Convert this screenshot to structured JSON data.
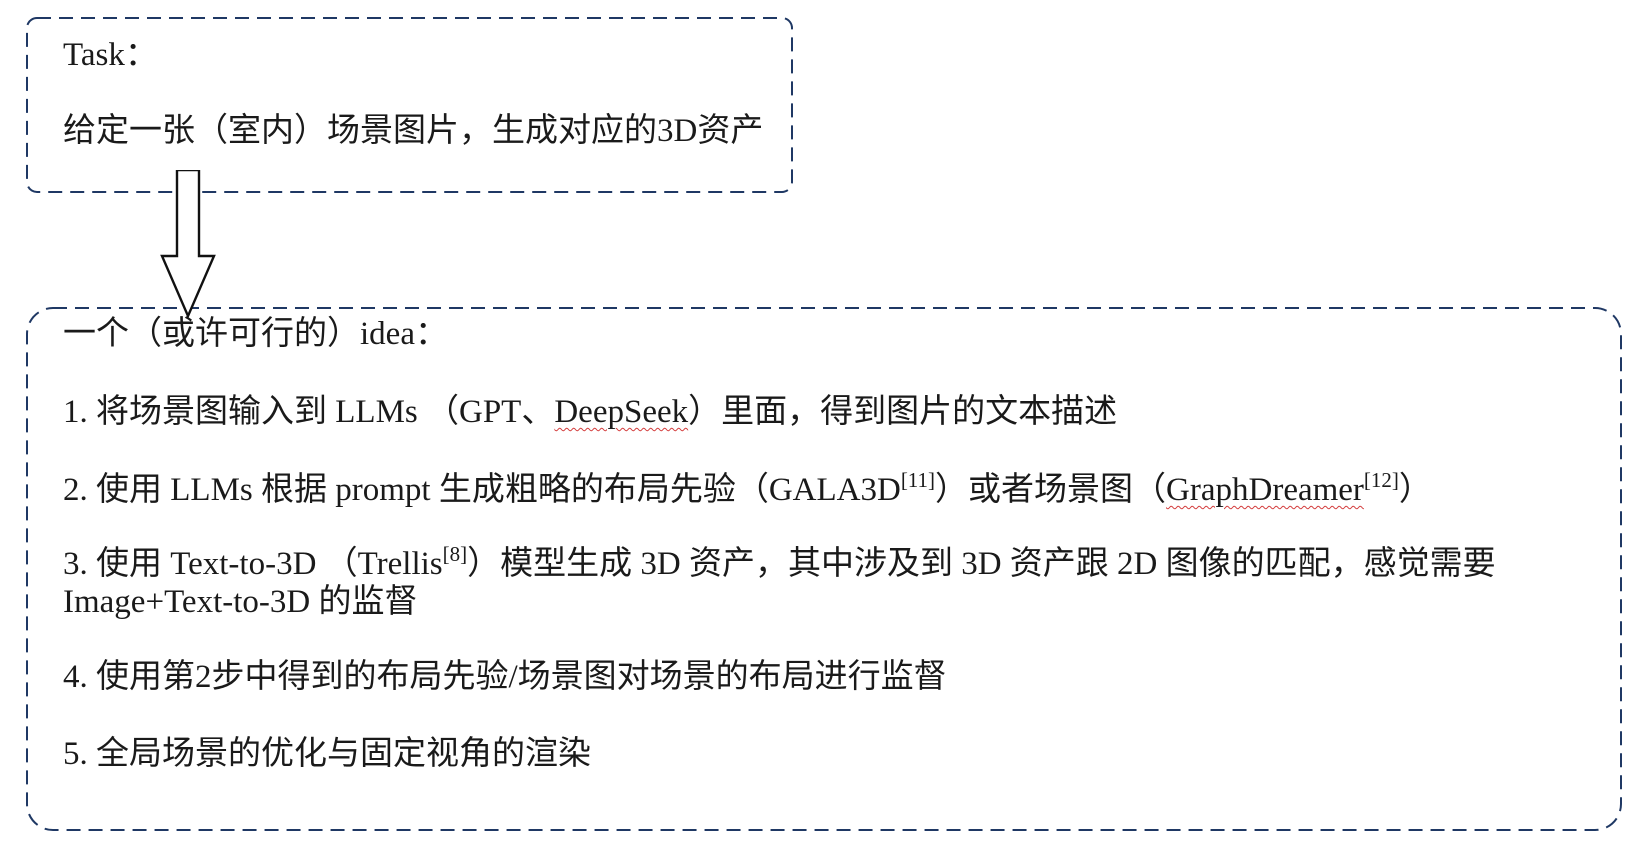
{
  "task": {
    "heading": "Task：",
    "description": "给定一张（室内）场景图片，生成对应的3D资产"
  },
  "idea": {
    "heading": "一个（或许可行的）idea：",
    "step1": {
      "pre": "1. 将场景图输入到 LLMs （GPT、",
      "deepseek": "DeepSeek",
      "post": "）里面，得到图片的文本描述"
    },
    "step2": {
      "pre": "2. 使用 LLMs 根据 prompt 生成粗略的布局先验（GALA3D",
      "cite1": "[11]",
      "mid": "）或者场景图（",
      "graphdreamer": "GraphDreamer",
      "cite2": "[12]",
      "post": "）"
    },
    "step3": {
      "pre": "3. 使用 Text-to-3D （Trellis",
      "cite": "[8]",
      "post": "）模型生成 3D 资产，其中涉及到 3D 资产跟 2D 图像的匹配，感觉需要",
      "line2": "Image+Text-to-3D 的监督"
    },
    "step4": "4. 使用第2步中得到的布局先验/场景图对场景的布局进行监督",
    "step5": "5. 全局场景的优化与固定视角的渲染"
  },
  "colors": {
    "border": "#1f3864",
    "text": "#1a1a1a",
    "spellcheck": "#d33b3b"
  }
}
